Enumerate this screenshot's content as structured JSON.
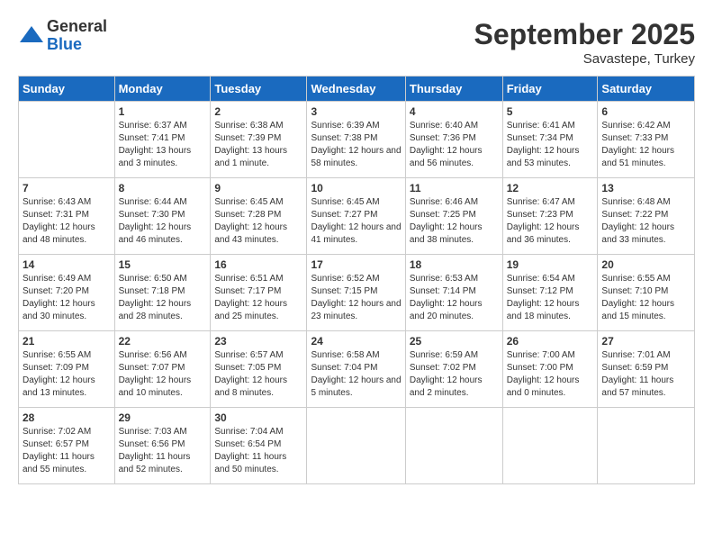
{
  "logo": {
    "general": "General",
    "blue": "Blue"
  },
  "header": {
    "month": "September 2025",
    "location": "Savastepe, Turkey"
  },
  "weekdays": [
    "Sunday",
    "Monday",
    "Tuesday",
    "Wednesday",
    "Thursday",
    "Friday",
    "Saturday"
  ],
  "weeks": [
    [
      {
        "day": "",
        "sunrise": "",
        "sunset": "",
        "daylight": ""
      },
      {
        "day": "1",
        "sunrise": "Sunrise: 6:37 AM",
        "sunset": "Sunset: 7:41 PM",
        "daylight": "Daylight: 13 hours and 3 minutes."
      },
      {
        "day": "2",
        "sunrise": "Sunrise: 6:38 AM",
        "sunset": "Sunset: 7:39 PM",
        "daylight": "Daylight: 13 hours and 1 minute."
      },
      {
        "day": "3",
        "sunrise": "Sunrise: 6:39 AM",
        "sunset": "Sunset: 7:38 PM",
        "daylight": "Daylight: 12 hours and 58 minutes."
      },
      {
        "day": "4",
        "sunrise": "Sunrise: 6:40 AM",
        "sunset": "Sunset: 7:36 PM",
        "daylight": "Daylight: 12 hours and 56 minutes."
      },
      {
        "day": "5",
        "sunrise": "Sunrise: 6:41 AM",
        "sunset": "Sunset: 7:34 PM",
        "daylight": "Daylight: 12 hours and 53 minutes."
      },
      {
        "day": "6",
        "sunrise": "Sunrise: 6:42 AM",
        "sunset": "Sunset: 7:33 PM",
        "daylight": "Daylight: 12 hours and 51 minutes."
      }
    ],
    [
      {
        "day": "7",
        "sunrise": "Sunrise: 6:43 AM",
        "sunset": "Sunset: 7:31 PM",
        "daylight": "Daylight: 12 hours and 48 minutes."
      },
      {
        "day": "8",
        "sunrise": "Sunrise: 6:44 AM",
        "sunset": "Sunset: 7:30 PM",
        "daylight": "Daylight: 12 hours and 46 minutes."
      },
      {
        "day": "9",
        "sunrise": "Sunrise: 6:45 AM",
        "sunset": "Sunset: 7:28 PM",
        "daylight": "Daylight: 12 hours and 43 minutes."
      },
      {
        "day": "10",
        "sunrise": "Sunrise: 6:45 AM",
        "sunset": "Sunset: 7:27 PM",
        "daylight": "Daylight: 12 hours and 41 minutes."
      },
      {
        "day": "11",
        "sunrise": "Sunrise: 6:46 AM",
        "sunset": "Sunset: 7:25 PM",
        "daylight": "Daylight: 12 hours and 38 minutes."
      },
      {
        "day": "12",
        "sunrise": "Sunrise: 6:47 AM",
        "sunset": "Sunset: 7:23 PM",
        "daylight": "Daylight: 12 hours and 36 minutes."
      },
      {
        "day": "13",
        "sunrise": "Sunrise: 6:48 AM",
        "sunset": "Sunset: 7:22 PM",
        "daylight": "Daylight: 12 hours and 33 minutes."
      }
    ],
    [
      {
        "day": "14",
        "sunrise": "Sunrise: 6:49 AM",
        "sunset": "Sunset: 7:20 PM",
        "daylight": "Daylight: 12 hours and 30 minutes."
      },
      {
        "day": "15",
        "sunrise": "Sunrise: 6:50 AM",
        "sunset": "Sunset: 7:18 PM",
        "daylight": "Daylight: 12 hours and 28 minutes."
      },
      {
        "day": "16",
        "sunrise": "Sunrise: 6:51 AM",
        "sunset": "Sunset: 7:17 PM",
        "daylight": "Daylight: 12 hours and 25 minutes."
      },
      {
        "day": "17",
        "sunrise": "Sunrise: 6:52 AM",
        "sunset": "Sunset: 7:15 PM",
        "daylight": "Daylight: 12 hours and 23 minutes."
      },
      {
        "day": "18",
        "sunrise": "Sunrise: 6:53 AM",
        "sunset": "Sunset: 7:14 PM",
        "daylight": "Daylight: 12 hours and 20 minutes."
      },
      {
        "day": "19",
        "sunrise": "Sunrise: 6:54 AM",
        "sunset": "Sunset: 7:12 PM",
        "daylight": "Daylight: 12 hours and 18 minutes."
      },
      {
        "day": "20",
        "sunrise": "Sunrise: 6:55 AM",
        "sunset": "Sunset: 7:10 PM",
        "daylight": "Daylight: 12 hours and 15 minutes."
      }
    ],
    [
      {
        "day": "21",
        "sunrise": "Sunrise: 6:55 AM",
        "sunset": "Sunset: 7:09 PM",
        "daylight": "Daylight: 12 hours and 13 minutes."
      },
      {
        "day": "22",
        "sunrise": "Sunrise: 6:56 AM",
        "sunset": "Sunset: 7:07 PM",
        "daylight": "Daylight: 12 hours and 10 minutes."
      },
      {
        "day": "23",
        "sunrise": "Sunrise: 6:57 AM",
        "sunset": "Sunset: 7:05 PM",
        "daylight": "Daylight: 12 hours and 8 minutes."
      },
      {
        "day": "24",
        "sunrise": "Sunrise: 6:58 AM",
        "sunset": "Sunset: 7:04 PM",
        "daylight": "Daylight: 12 hours and 5 minutes."
      },
      {
        "day": "25",
        "sunrise": "Sunrise: 6:59 AM",
        "sunset": "Sunset: 7:02 PM",
        "daylight": "Daylight: 12 hours and 2 minutes."
      },
      {
        "day": "26",
        "sunrise": "Sunrise: 7:00 AM",
        "sunset": "Sunset: 7:00 PM",
        "daylight": "Daylight: 12 hours and 0 minutes."
      },
      {
        "day": "27",
        "sunrise": "Sunrise: 7:01 AM",
        "sunset": "Sunset: 6:59 PM",
        "daylight": "Daylight: 11 hours and 57 minutes."
      }
    ],
    [
      {
        "day": "28",
        "sunrise": "Sunrise: 7:02 AM",
        "sunset": "Sunset: 6:57 PM",
        "daylight": "Daylight: 11 hours and 55 minutes."
      },
      {
        "day": "29",
        "sunrise": "Sunrise: 7:03 AM",
        "sunset": "Sunset: 6:56 PM",
        "daylight": "Daylight: 11 hours and 52 minutes."
      },
      {
        "day": "30",
        "sunrise": "Sunrise: 7:04 AM",
        "sunset": "Sunset: 6:54 PM",
        "daylight": "Daylight: 11 hours and 50 minutes."
      },
      {
        "day": "",
        "sunrise": "",
        "sunset": "",
        "daylight": ""
      },
      {
        "day": "",
        "sunrise": "",
        "sunset": "",
        "daylight": ""
      },
      {
        "day": "",
        "sunrise": "",
        "sunset": "",
        "daylight": ""
      },
      {
        "day": "",
        "sunrise": "",
        "sunset": "",
        "daylight": ""
      }
    ]
  ]
}
